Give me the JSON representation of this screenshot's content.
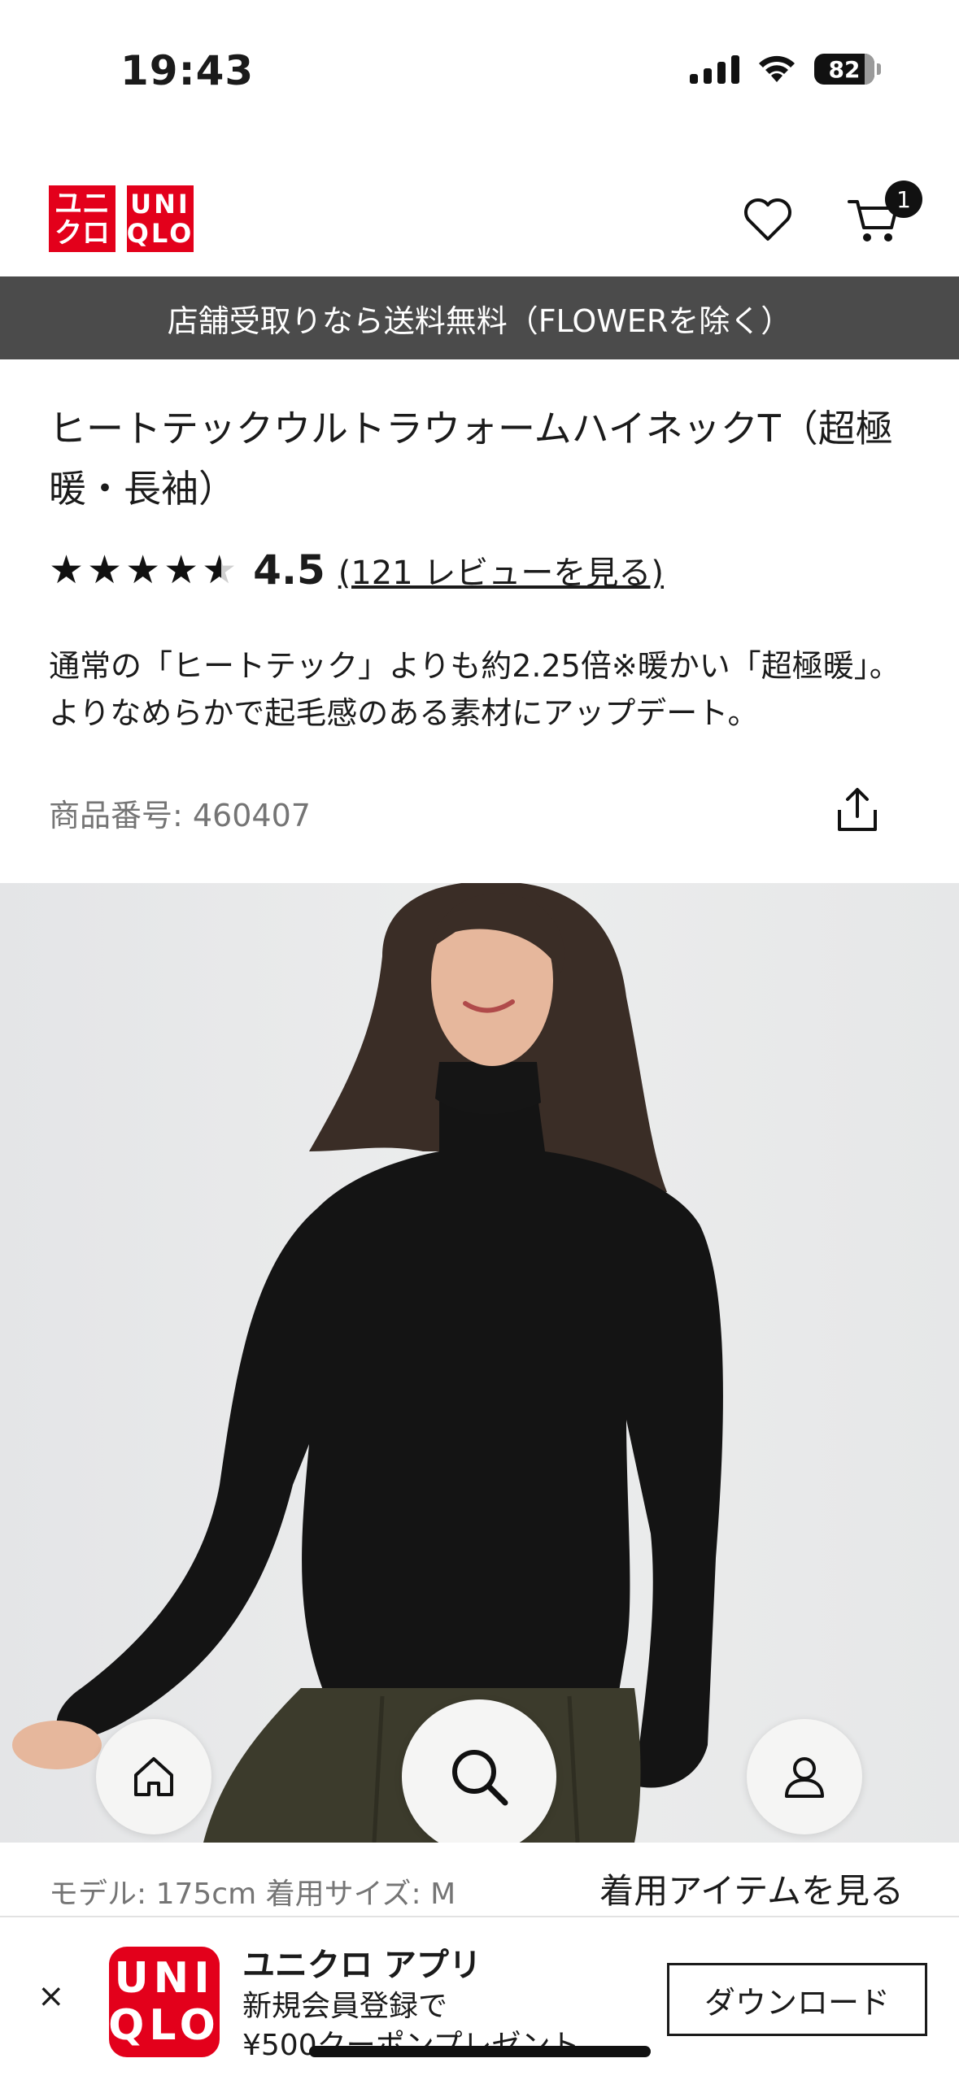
{
  "status_bar": {
    "time": "19:43",
    "battery": "82",
    "signal_icon": "cellular-signal-icon",
    "wifi_icon": "wifi-icon"
  },
  "header": {
    "logo_jp_line1": "ユニ",
    "logo_jp_line2": "クロ",
    "logo_en_line1": "UNI",
    "logo_en_line2": "QLO",
    "wishlist_icon": "heart-icon",
    "cart_icon": "cart-icon",
    "cart_count": "1"
  },
  "promo_banner": "店舗受取りなら送料無料（FLOWERを除く）",
  "product": {
    "title": "ヒートテックウルトラウォームハイネックT（超極暖・長袖）",
    "rating": 4.5,
    "rating_text": "4.5",
    "stars_full": "★★★★",
    "star_half": "★",
    "review_link": "(121 レビューを見る)",
    "description": "通常の「ヒートテック」よりも約2.25倍※暖かい「超極暖」。よりなめらかで起毛感のある素材にアップデート。",
    "product_number": "商品番号: 460407",
    "share_icon": "share-icon"
  },
  "bottom_nav": {
    "home_icon": "home-icon",
    "search_icon": "search-icon",
    "account_icon": "user-icon"
  },
  "model_info": {
    "text": "モデル: 175cm 着用サイズ: M",
    "worn_items_link": "着用アイテムを見る"
  },
  "app_banner": {
    "close": "×",
    "logo_line1": "UNI",
    "logo_line2": "QLO",
    "title": "ユニクロ アプリ",
    "text_line1": "新規会員登録で",
    "text_line2": "¥500クーポンプレゼント",
    "download_label": "ダウンロード"
  },
  "colors": {
    "brand_red": "#e3001b",
    "promo_bg": "#4b4b4b",
    "text": "#1b1b1b",
    "muted": "#757575"
  }
}
